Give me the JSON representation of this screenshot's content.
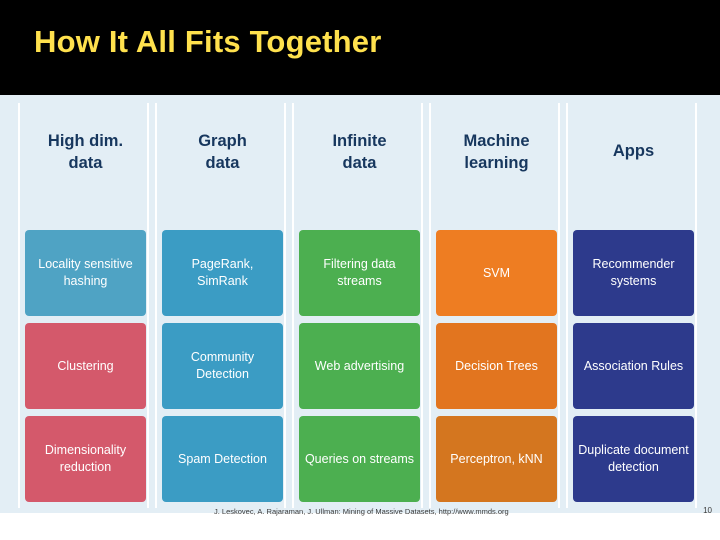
{
  "slide": {
    "title": "How It All Fits Together",
    "title_color": "#ffe14d",
    "band_color": "#000000",
    "body_background": "#e3eef5",
    "footer_note": "J. Leskovec, A. Rajaraman, J. Ullman: Mining of Massive Datasets, http://www.mmds.org",
    "page_number": "10"
  },
  "columns": [
    {
      "header": "High dim.\ndata",
      "header_line1": "High dim.",
      "header_line2": "data",
      "cells": [
        {
          "label": "Locality sensitive hashing",
          "color": "#4fa3c4"
        },
        {
          "label": "Clustering",
          "color": "#d4596b"
        },
        {
          "label": "Dimensionality reduction",
          "color": "#d4596b"
        }
      ]
    },
    {
      "header": "Graph\ndata",
      "header_line1": "Graph",
      "header_line2": "data",
      "cells": [
        {
          "label": "PageRank, SimRank",
          "color": "#3b9cc4"
        },
        {
          "label": "Community Detection",
          "color": "#3b9cc4"
        },
        {
          "label": "Spam Detection",
          "color": "#3b9cc4"
        }
      ]
    },
    {
      "header": "Infinite\ndata",
      "header_line1": "Infinite",
      "header_line2": "data",
      "cells": [
        {
          "label": "Filtering data streams",
          "color": "#4caf50"
        },
        {
          "label": "Web advertising",
          "color": "#4caf50"
        },
        {
          "label": "Queries on streams",
          "color": "#4caf50"
        }
      ]
    },
    {
      "header": "Machine\nlearning",
      "header_line1": "Machine",
      "header_line2": "learning",
      "cells": [
        {
          "label": "SVM",
          "color": "#ee7d22"
        },
        {
          "label": "Decision Trees",
          "color": "#e2751f"
        },
        {
          "label": "Perceptron, kNN",
          "color": "#d4761f"
        }
      ]
    },
    {
      "header": "Apps",
      "header_line1": "Apps",
      "header_line2": "",
      "cells": [
        {
          "label": "Recommender systems",
          "color": "#2d3a8c"
        },
        {
          "label": "Association Rules",
          "color": "#2d3a8c"
        },
        {
          "label": "Duplicate document detection",
          "color": "#2d3a8c"
        }
      ]
    }
  ]
}
